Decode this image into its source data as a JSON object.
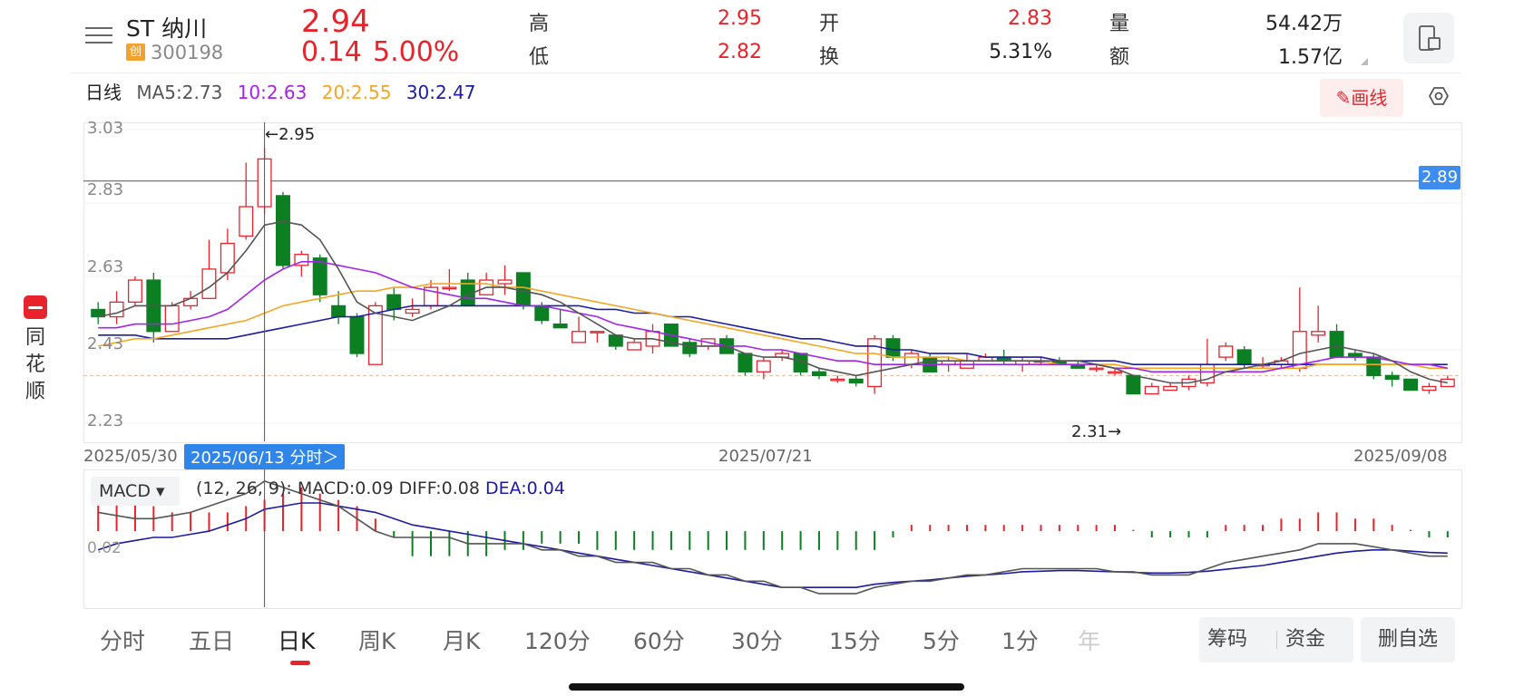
{
  "stock": {
    "name": "ST 纳川",
    "board_badge": "创",
    "code": "300198",
    "price": "2.94",
    "change": "0.14",
    "change_pct": "5.00%"
  },
  "quote": {
    "high_label": "高",
    "high": "2.95",
    "low_label": "低",
    "low": "2.82",
    "open_label": "开",
    "open": "2.83",
    "turnover_label": "换",
    "turnover": "5.31%",
    "volume_label": "量",
    "volume": "54.42万",
    "amount_label": "额",
    "amount": "1.57亿"
  },
  "sidebar": {
    "logo": "logo-icon",
    "chars": [
      "同",
      "花",
      "顺"
    ]
  },
  "toolbar": {
    "draw_button": "画线",
    "settings_icon": "hexagon-settings-icon",
    "rotate_icon": "rotate-screen-icon"
  },
  "ma": {
    "period_label": "日线",
    "ma5": "MA5:2.73",
    "ma10": "10:2.63",
    "ma20": "20:2.55",
    "ma30": "30:2.47",
    "colors": {
      "ma5": "#555555",
      "ma10": "#a323e8",
      "ma20": "#f5a623",
      "ma30": "#1c1ca0"
    }
  },
  "crosshair": {
    "price_marker": "←2.95",
    "price_tag": "2.89",
    "low_marker": "2.31→",
    "date_tag": "2025/06/13 分时＞"
  },
  "dates": {
    "start": "2025/05/30",
    "mid": "2025/07/21",
    "end": "2025/09/08"
  },
  "colors": {
    "up": "#e8232c",
    "down": "#0d7f23",
    "accent": "#3d8cf0"
  },
  "chart_data": [
    {
      "type": "candlestick",
      "title": "",
      "y_ticks": [
        "3.03",
        "2.83",
        "2.63",
        "2.43",
        "2.23"
      ],
      "ylim": [
        2.23,
        3.03
      ],
      "x_labels": [
        "2025/05/30",
        "2025/07/21",
        "2025/09/08"
      ],
      "candles": [
        [
          2.54,
          2.52,
          2.56,
          2.5
        ],
        [
          2.52,
          2.56,
          2.59,
          2.5
        ],
        [
          2.56,
          2.62,
          2.63,
          2.55
        ],
        [
          2.62,
          2.48,
          2.64,
          2.45
        ],
        [
          2.48,
          2.55,
          2.56,
          2.48
        ],
        [
          2.55,
          2.57,
          2.59,
          2.54
        ],
        [
          2.57,
          2.65,
          2.73,
          2.57
        ],
        [
          2.64,
          2.72,
          2.76,
          2.62
        ],
        [
          2.74,
          2.82,
          2.94,
          2.73
        ],
        [
          2.82,
          2.95,
          2.98,
          2.8
        ],
        [
          2.85,
          2.66,
          2.86,
          2.65
        ],
        [
          2.66,
          2.69,
          2.7,
          2.63
        ],
        [
          2.68,
          2.58,
          2.69,
          2.56
        ],
        [
          2.55,
          2.52,
          2.59,
          2.5
        ],
        [
          2.52,
          2.42,
          2.53,
          2.41
        ],
        [
          2.39,
          2.55,
          2.56,
          2.39
        ],
        [
          2.58,
          2.54,
          2.6,
          2.51
        ],
        [
          2.53,
          2.54,
          2.57,
          2.52
        ],
        [
          2.55,
          2.6,
          2.62,
          2.54
        ],
        [
          2.6,
          2.6,
          2.65,
          2.59
        ],
        [
          2.62,
          2.55,
          2.64,
          2.55
        ],
        [
          2.58,
          2.62,
          2.64,
          2.58
        ],
        [
          2.61,
          2.62,
          2.66,
          2.58
        ],
        [
          2.64,
          2.55,
          2.64,
          2.54
        ],
        [
          2.55,
          2.51,
          2.56,
          2.5
        ],
        [
          2.5,
          2.49,
          2.54,
          2.49
        ],
        [
          2.45,
          2.48,
          2.52,
          2.45
        ],
        [
          2.48,
          2.48,
          2.48,
          2.45
        ],
        [
          2.47,
          2.44,
          2.47,
          2.43
        ],
        [
          2.43,
          2.45,
          2.46,
          2.43
        ],
        [
          2.44,
          2.48,
          2.5,
          2.42
        ],
        [
          2.5,
          2.44,
          2.5,
          2.44
        ],
        [
          2.45,
          2.42,
          2.46,
          2.41
        ],
        [
          2.44,
          2.46,
          2.46,
          2.43
        ],
        [
          2.46,
          2.42,
          2.47,
          2.42
        ],
        [
          2.42,
          2.37,
          2.42,
          2.36
        ],
        [
          2.37,
          2.4,
          2.41,
          2.35
        ],
        [
          2.41,
          2.42,
          2.43,
          2.4
        ],
        [
          2.42,
          2.37,
          2.42,
          2.36
        ],
        [
          2.37,
          2.36,
          2.38,
          2.35
        ],
        [
          2.35,
          2.35,
          2.36,
          2.34
        ],
        [
          2.35,
          2.34,
          2.36,
          2.33
        ],
        [
          2.33,
          2.46,
          2.47,
          2.31
        ],
        [
          2.46,
          2.41,
          2.47,
          2.4
        ],
        [
          2.39,
          2.42,
          2.43,
          2.38
        ],
        [
          2.41,
          2.37,
          2.42,
          2.37
        ],
        [
          2.39,
          2.4,
          2.41,
          2.37
        ],
        [
          2.38,
          2.4,
          2.42,
          2.38
        ],
        [
          2.4,
          2.41,
          2.42,
          2.4
        ],
        [
          2.41,
          2.4,
          2.43,
          2.39
        ],
        [
          2.39,
          2.4,
          2.41,
          2.37
        ],
        [
          2.4,
          2.4,
          2.41,
          2.39
        ],
        [
          2.4,
          2.39,
          2.41,
          2.39
        ],
        [
          2.39,
          2.38,
          2.4,
          2.38
        ],
        [
          2.38,
          2.38,
          2.39,
          2.37
        ],
        [
          2.37,
          2.37,
          2.38,
          2.36
        ],
        [
          2.36,
          2.31,
          2.36,
          2.31
        ],
        [
          2.31,
          2.33,
          2.34,
          2.31
        ],
        [
          2.32,
          2.33,
          2.34,
          2.32
        ],
        [
          2.33,
          2.35,
          2.36,
          2.32
        ],
        [
          2.34,
          2.39,
          2.46,
          2.33
        ],
        [
          2.41,
          2.44,
          2.45,
          2.4
        ],
        [
          2.43,
          2.39,
          2.44,
          2.38
        ],
        [
          2.39,
          2.39,
          2.41,
          2.38
        ],
        [
          2.39,
          2.4,
          2.41,
          2.38
        ],
        [
          2.38,
          2.48,
          2.6,
          2.37
        ],
        [
          2.47,
          2.48,
          2.55,
          2.45
        ],
        [
          2.48,
          2.41,
          2.5,
          2.41
        ],
        [
          2.42,
          2.41,
          2.43,
          2.4
        ],
        [
          2.41,
          2.36,
          2.42,
          2.35
        ],
        [
          2.36,
          2.35,
          2.37,
          2.33
        ],
        [
          2.35,
          2.32,
          2.35,
          2.32
        ],
        [
          2.32,
          2.33,
          2.34,
          2.31
        ],
        [
          2.33,
          2.35,
          2.36,
          2.33
        ]
      ],
      "ma5": [
        2.52,
        2.53,
        2.55,
        2.55,
        2.55,
        2.57,
        2.6,
        2.64,
        2.7,
        2.77,
        2.78,
        2.77,
        2.73,
        2.65,
        2.56,
        2.53,
        2.52,
        2.51,
        2.53,
        2.55,
        2.58,
        2.6,
        2.6,
        2.59,
        2.58,
        2.56,
        2.53,
        2.5,
        2.47,
        2.46,
        2.46,
        2.45,
        2.44,
        2.44,
        2.44,
        2.42,
        2.41,
        2.41,
        2.4,
        2.38,
        2.37,
        2.36,
        2.37,
        2.38,
        2.39,
        2.4,
        2.4,
        2.4,
        2.4,
        2.4,
        2.4,
        2.4,
        2.4,
        2.4,
        2.39,
        2.38,
        2.36,
        2.35,
        2.34,
        2.34,
        2.35,
        2.37,
        2.38,
        2.39,
        2.4,
        2.42,
        2.43,
        2.44,
        2.43,
        2.42,
        2.4,
        2.37,
        2.35,
        2.34
      ],
      "ma10": [
        2.49,
        2.49,
        2.5,
        2.5,
        2.5,
        2.51,
        2.52,
        2.54,
        2.58,
        2.62,
        2.65,
        2.67,
        2.67,
        2.66,
        2.65,
        2.64,
        2.62,
        2.6,
        2.59,
        2.58,
        2.57,
        2.57,
        2.56,
        2.55,
        2.55,
        2.54,
        2.53,
        2.52,
        2.5,
        2.49,
        2.48,
        2.47,
        2.46,
        2.45,
        2.44,
        2.44,
        2.43,
        2.43,
        2.42,
        2.41,
        2.4,
        2.4,
        2.39,
        2.39,
        2.39,
        2.39,
        2.39,
        2.39,
        2.39,
        2.39,
        2.39,
        2.39,
        2.39,
        2.39,
        2.39,
        2.38,
        2.38,
        2.37,
        2.37,
        2.37,
        2.37,
        2.37,
        2.37,
        2.37,
        2.38,
        2.39,
        2.4,
        2.41,
        2.41,
        2.41,
        2.4,
        2.39,
        2.39,
        2.38
      ],
      "ma20": [
        2.44,
        2.45,
        2.46,
        2.46,
        2.47,
        2.48,
        2.49,
        2.5,
        2.51,
        2.53,
        2.55,
        2.56,
        2.57,
        2.58,
        2.59,
        2.59,
        2.6,
        2.6,
        2.61,
        2.61,
        2.61,
        2.61,
        2.6,
        2.6,
        2.59,
        2.58,
        2.57,
        2.56,
        2.55,
        2.54,
        2.53,
        2.52,
        2.51,
        2.5,
        2.49,
        2.48,
        2.47,
        2.46,
        2.45,
        2.44,
        2.43,
        2.42,
        2.42,
        2.41,
        2.41,
        2.41,
        2.41,
        2.4,
        2.4,
        2.4,
        2.4,
        2.4,
        2.39,
        2.39,
        2.39,
        2.39,
        2.38,
        2.38,
        2.38,
        2.38,
        2.38,
        2.38,
        2.38,
        2.38,
        2.38,
        2.38,
        2.39,
        2.39,
        2.39,
        2.39,
        2.39,
        2.39,
        2.38,
        2.38
      ],
      "ma30": [
        2.47,
        2.47,
        2.47,
        2.46,
        2.46,
        2.46,
        2.46,
        2.46,
        2.47,
        2.48,
        2.49,
        2.5,
        2.51,
        2.52,
        2.52,
        2.53,
        2.54,
        2.55,
        2.55,
        2.55,
        2.55,
        2.55,
        2.55,
        2.55,
        2.55,
        2.55,
        2.55,
        2.54,
        2.54,
        2.53,
        2.53,
        2.52,
        2.52,
        2.51,
        2.5,
        2.49,
        2.48,
        2.47,
        2.46,
        2.46,
        2.45,
        2.44,
        2.44,
        2.43,
        2.43,
        2.42,
        2.42,
        2.42,
        2.41,
        2.41,
        2.41,
        2.41,
        2.4,
        2.4,
        2.4,
        2.4,
        2.39,
        2.39,
        2.39,
        2.39,
        2.39,
        2.39,
        2.39,
        2.39,
        2.39,
        2.39,
        2.39,
        2.39,
        2.39,
        2.39,
        2.39,
        2.39,
        2.39,
        2.39
      ]
    },
    {
      "type": "macd",
      "title": "",
      "selector_label": "MACD ▾",
      "params": "(12, 26, 9):",
      "macd_label": "MACD:0.09",
      "diff_label": "DIFF:0.08",
      "dea_label": "DEA:0.04",
      "y_tick": "0.02",
      "colors": {
        "diff": "#555555",
        "dea": "#1c1ca0"
      },
      "hist": [
        0.05,
        0.05,
        0.05,
        0.04,
        0.03,
        0.03,
        0.03,
        0.03,
        0.04,
        0.05,
        0.06,
        0.07,
        0.06,
        0.05,
        0.04,
        0.02,
        -0.01,
        -0.04,
        -0.04,
        -0.04,
        -0.04,
        -0.04,
        -0.03,
        -0.03,
        -0.02,
        -0.02,
        -0.02,
        -0.03,
        -0.03,
        -0.03,
        -0.03,
        -0.03,
        -0.03,
        -0.03,
        -0.03,
        -0.03,
        -0.03,
        -0.03,
        -0.03,
        -0.03,
        -0.03,
        -0.03,
        -0.03,
        -0.01,
        0.01,
        0.01,
        0.01,
        0.01,
        0.01,
        0.01,
        0.01,
        0.01,
        0.01,
        0.01,
        0.01,
        0.01,
        0.0,
        -0.01,
        -0.01,
        -0.01,
        -0.01,
        0.01,
        0.01,
        0.01,
        0.02,
        0.02,
        0.03,
        0.03,
        0.02,
        0.02,
        0.01,
        0.0,
        -0.01,
        -0.01
      ],
      "diff": [
        0.03,
        0.025,
        0.02,
        0.02,
        0.025,
        0.03,
        0.04,
        0.05,
        0.06,
        0.08,
        0.07,
        0.06,
        0.05,
        0.04,
        0.02,
        0.0,
        -0.01,
        -0.01,
        -0.01,
        -0.01,
        -0.02,
        -0.02,
        -0.02,
        -0.02,
        -0.03,
        -0.03,
        -0.04,
        -0.04,
        -0.05,
        -0.05,
        -0.05,
        -0.06,
        -0.06,
        -0.07,
        -0.07,
        -0.08,
        -0.08,
        -0.09,
        -0.09,
        -0.1,
        -0.1,
        -0.1,
        -0.09,
        -0.085,
        -0.08,
        -0.08,
        -0.075,
        -0.07,
        -0.07,
        -0.065,
        -0.06,
        -0.06,
        -0.06,
        -0.06,
        -0.06,
        -0.065,
        -0.065,
        -0.07,
        -0.07,
        -0.07,
        -0.06,
        -0.05,
        -0.045,
        -0.04,
        -0.035,
        -0.03,
        -0.02,
        -0.02,
        -0.02,
        -0.025,
        -0.03,
        -0.035,
        -0.04,
        -0.04
      ],
      "dea": [
        -0.03,
        -0.02,
        -0.015,
        -0.01,
        -0.01,
        -0.005,
        0.0,
        0.01,
        0.02,
        0.035,
        0.04,
        0.045,
        0.045,
        0.04,
        0.035,
        0.03,
        0.02,
        0.01,
        0.005,
        0.0,
        -0.005,
        -0.01,
        -0.015,
        -0.02,
        -0.025,
        -0.03,
        -0.035,
        -0.04,
        -0.045,
        -0.05,
        -0.055,
        -0.06,
        -0.065,
        -0.07,
        -0.075,
        -0.08,
        -0.085,
        -0.09,
        -0.09,
        -0.09,
        -0.09,
        -0.09,
        -0.085,
        -0.082,
        -0.08,
        -0.078,
        -0.075,
        -0.072,
        -0.07,
        -0.068,
        -0.065,
        -0.064,
        -0.063,
        -0.063,
        -0.064,
        -0.065,
        -0.066,
        -0.067,
        -0.067,
        -0.066,
        -0.064,
        -0.061,
        -0.058,
        -0.055,
        -0.05,
        -0.045,
        -0.04,
        -0.035,
        -0.032,
        -0.03,
        -0.03,
        -0.032,
        -0.034,
        -0.035
      ]
    }
  ],
  "tabs": [
    "分时",
    "五日",
    "日K",
    "周K",
    "月K",
    "120分",
    "60分",
    "30分",
    "15分",
    "5分",
    "1分",
    "年"
  ],
  "active_tab": "日K",
  "buttons": {
    "chips": "筹码",
    "funds": "资金",
    "remove": "删自选"
  }
}
